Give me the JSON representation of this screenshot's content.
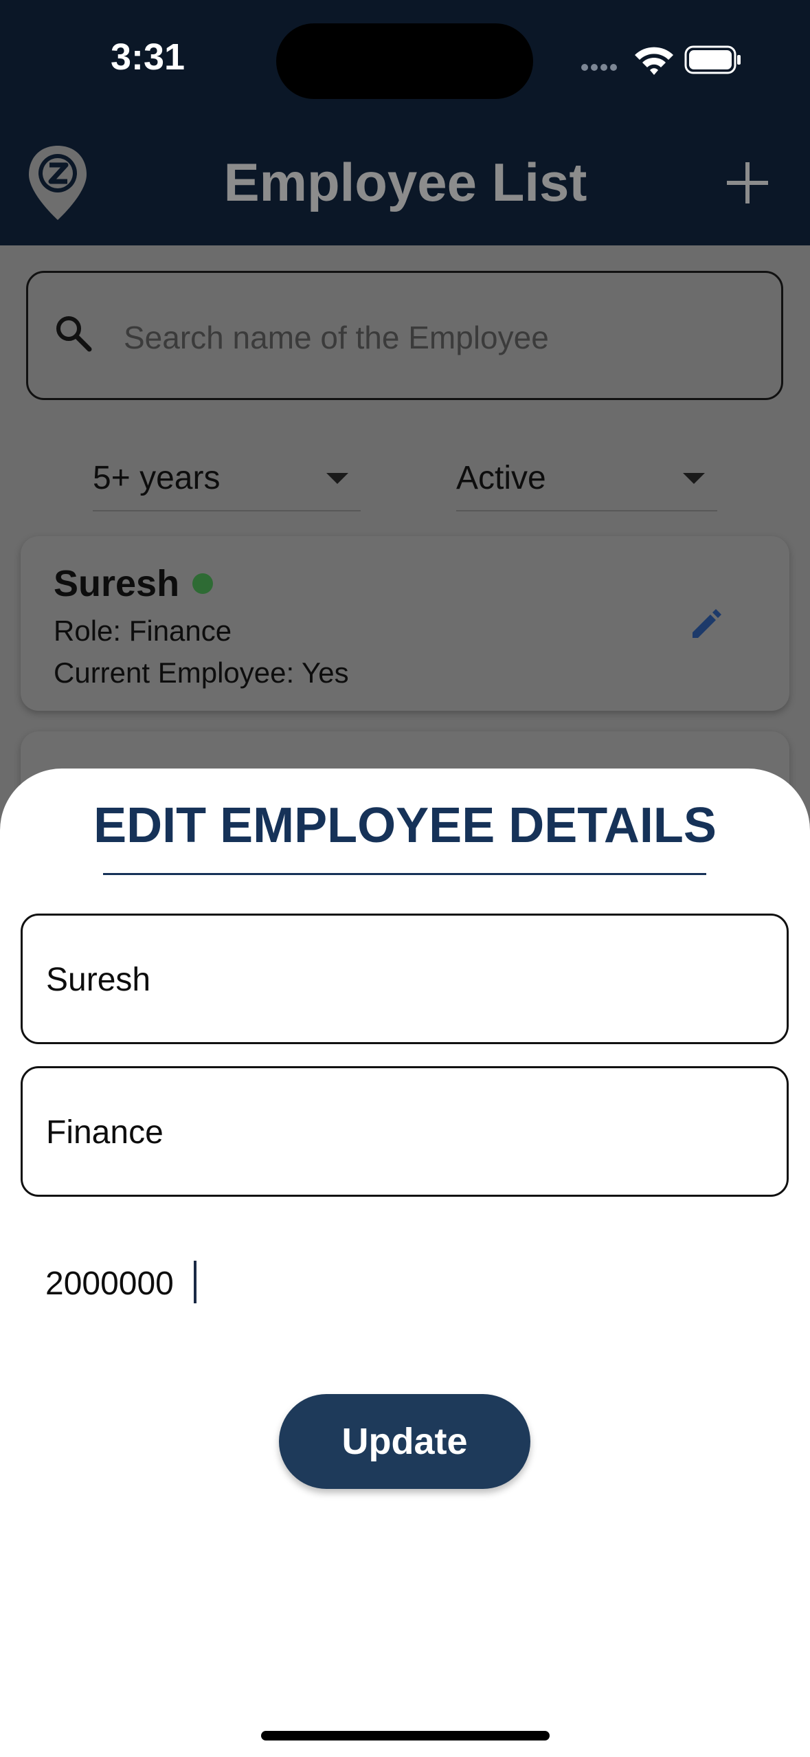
{
  "status_bar": {
    "time": "3:31"
  },
  "header": {
    "title": "Employee List",
    "logo_icon": "z-location-pin-icon",
    "add_icon": "plus-icon"
  },
  "search": {
    "placeholder": "Search name of the Employee",
    "icon": "search-icon"
  },
  "filters": {
    "experience": "5+ years",
    "status": "Active"
  },
  "employees": [
    {
      "name": "Suresh",
      "role": "Role: Finance",
      "current": "Current Employee: Yes",
      "status_color": "#2e6b34"
    }
  ],
  "edit_sheet": {
    "title": "EDIT EMPLOYEE DETAILS",
    "name_value": "Suresh",
    "role_value": "Finance",
    "salary_value": "2000000",
    "update_label": "Update"
  },
  "colors": {
    "header_bg": "#0b1727",
    "accent": "#163258",
    "button_bg": "#1e3a5a",
    "overlay": "#6c6c6c"
  }
}
